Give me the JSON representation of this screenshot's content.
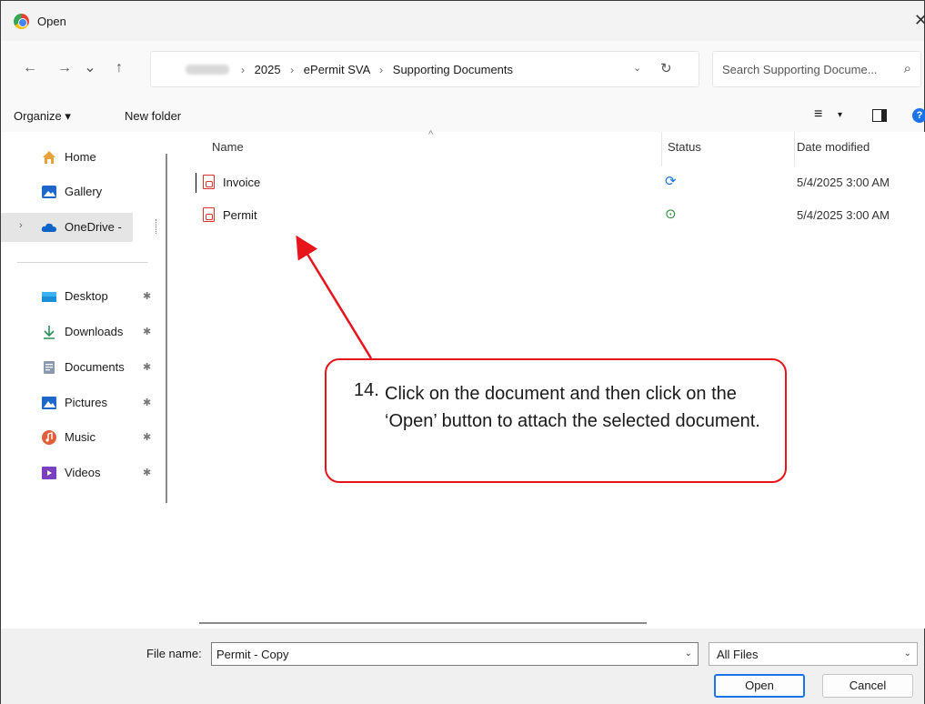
{
  "window": {
    "title": "Open",
    "close_glyph": "✕"
  },
  "nav": {
    "back": "←",
    "forward": "→",
    "recent": "⌄",
    "up": "↑",
    "breadcrumb": [
      "2025",
      "ePermit SVA",
      "Supporting Documents"
    ],
    "breadcrumb_sep": "›",
    "dropdown": "⌄",
    "refresh": "↻",
    "search_placeholder": "Search Supporting Docume...",
    "search_icon": "⌕"
  },
  "toolbar": {
    "organize": "Organize ▾",
    "new_folder": "New folder",
    "view_icon": "≡",
    "view_drop": "▾",
    "help": "?"
  },
  "sidebar": {
    "items": [
      {
        "label": "Home",
        "icon": "home-icon",
        "pinned": false
      },
      {
        "label": "Gallery",
        "icon": "gallery-icon",
        "pinned": false
      },
      {
        "label": "OneDrive -",
        "icon": "cloud-icon",
        "pinned": false,
        "expander": "›"
      },
      {
        "label": "Desktop",
        "icon": "desktop-icon",
        "pinned": true
      },
      {
        "label": "Downloads",
        "icon": "download-icon",
        "pinned": true
      },
      {
        "label": "Documents",
        "icon": "documents-icon",
        "pinned": true
      },
      {
        "label": "Pictures",
        "icon": "pictures-icon",
        "pinned": true
      },
      {
        "label": "Music",
        "icon": "music-icon",
        "pinned": true
      },
      {
        "label": "Videos",
        "icon": "videos-icon",
        "pinned": true
      }
    ],
    "pin_glyph": "✱"
  },
  "list": {
    "columns": {
      "name": "Name",
      "status": "Status",
      "date": "Date modified"
    },
    "sort_caret": "^",
    "files": [
      {
        "name": "Invoice",
        "status_glyph": "⟳",
        "status_color": "#1a73e8",
        "date": "5/4/2025 3:00 AM"
      },
      {
        "name": "Permit",
        "status_glyph": "⊙",
        "status_color": "#2e8b3a",
        "date": "5/4/2025 3:00 AM"
      }
    ]
  },
  "callout": {
    "number": "14.",
    "text": "Click on the document and then click on the ‘Open’ button to attach the selected document.",
    "color": "#e8141b"
  },
  "footer": {
    "file_name_label": "File name:",
    "file_name_value": "Permit - Copy",
    "filter_value": "All Files",
    "open": "Open",
    "cancel": "Cancel",
    "drop": "⌄"
  }
}
